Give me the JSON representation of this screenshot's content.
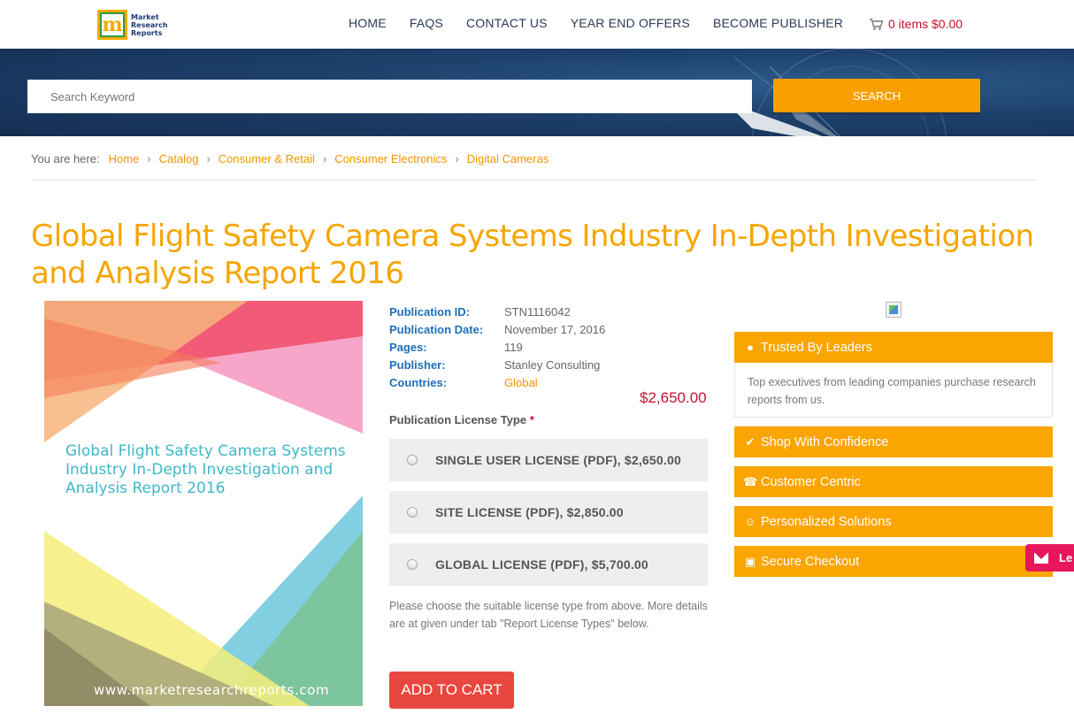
{
  "header": {
    "logo_text": [
      "Market",
      "Research",
      "Reports"
    ],
    "nav": [
      "HOME",
      "FAQS",
      "CONTACT US",
      "YEAR END OFFERS",
      "BECOME PUBLISHER"
    ],
    "cart_label": "0 items $0.00"
  },
  "search": {
    "placeholder": "Search Keyword",
    "button_label": "SEARCH"
  },
  "breadcrumb": {
    "lead": "You are here:",
    "items": [
      "Home",
      "Catalog",
      "Consumer & Retail",
      "Consumer Electronics",
      "Digital Cameras"
    ]
  },
  "report": {
    "title": "Global Flight Safety Camera Systems Industry In-Depth Investigation and Analysis Report 2016",
    "cover_title": "Global Flight Safety Camera Systems Industry In-Depth Investigation and Analysis Report 2016",
    "cover_url": "www.marketresearchreports.com",
    "meta": [
      {
        "label": "Publication ID:",
        "value": "STN1116042"
      },
      {
        "label": "Publication Date:",
        "value": "November 17, 2016"
      },
      {
        "label": "Pages:",
        "value": "119"
      },
      {
        "label": "Publisher:",
        "value": "Stanley Consulting"
      },
      {
        "label": "Countries:",
        "value": "Global"
      }
    ],
    "price": "$2,650.00",
    "license_heading": "Publication License Type",
    "license_required_mark": "*",
    "licenses": [
      "SINGLE USER LICENSE (PDF), $2,650.00",
      "SITE LICENSE (PDF), $2,850.00",
      "GLOBAL LICENSE (PDF), $5,700.00"
    ],
    "note": "Please choose the suitable license type from above. More details are at given under tab \"Report License Types\" below.",
    "add_to_cart": "ADD TO CART"
  },
  "sidebar": {
    "trusted_title": "Trusted By Leaders",
    "trusted_body": "Top executives from leading companies purchase research reports from us.",
    "boxes": [
      "Shop With Confidence",
      "Customer Centric",
      "Personalized Solutions",
      "Secure Checkout"
    ]
  },
  "mail_tab": {
    "label": "Le"
  },
  "colors": {
    "accent_orange": "#f6a500",
    "link_orange": "#f29400",
    "price_red": "#c8102e",
    "label_blue": "#1e6fb7",
    "button_red": "#e8473f",
    "banner_navy": "#1d406b"
  }
}
